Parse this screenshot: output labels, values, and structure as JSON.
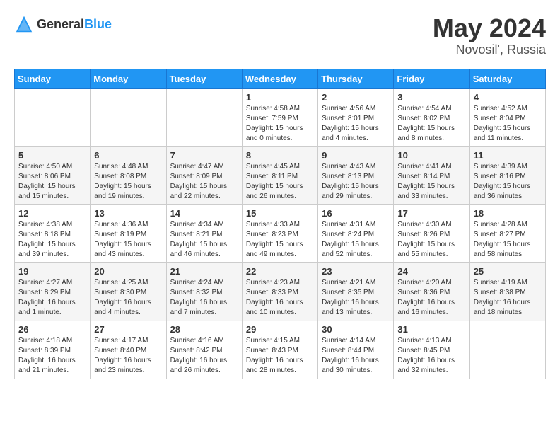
{
  "logo": {
    "general": "General",
    "blue": "Blue"
  },
  "title": {
    "month_year": "May 2024",
    "location": "Novosil', Russia"
  },
  "headers": [
    "Sunday",
    "Monday",
    "Tuesday",
    "Wednesday",
    "Thursday",
    "Friday",
    "Saturday"
  ],
  "weeks": [
    [
      {
        "day": "",
        "info": ""
      },
      {
        "day": "",
        "info": ""
      },
      {
        "day": "",
        "info": ""
      },
      {
        "day": "1",
        "info": "Sunrise: 4:58 AM\nSunset: 7:59 PM\nDaylight: 15 hours\nand 0 minutes."
      },
      {
        "day": "2",
        "info": "Sunrise: 4:56 AM\nSunset: 8:01 PM\nDaylight: 15 hours\nand 4 minutes."
      },
      {
        "day": "3",
        "info": "Sunrise: 4:54 AM\nSunset: 8:02 PM\nDaylight: 15 hours\nand 8 minutes."
      },
      {
        "day": "4",
        "info": "Sunrise: 4:52 AM\nSunset: 8:04 PM\nDaylight: 15 hours\nand 11 minutes."
      }
    ],
    [
      {
        "day": "5",
        "info": "Sunrise: 4:50 AM\nSunset: 8:06 PM\nDaylight: 15 hours\nand 15 minutes."
      },
      {
        "day": "6",
        "info": "Sunrise: 4:48 AM\nSunset: 8:08 PM\nDaylight: 15 hours\nand 19 minutes."
      },
      {
        "day": "7",
        "info": "Sunrise: 4:47 AM\nSunset: 8:09 PM\nDaylight: 15 hours\nand 22 minutes."
      },
      {
        "day": "8",
        "info": "Sunrise: 4:45 AM\nSunset: 8:11 PM\nDaylight: 15 hours\nand 26 minutes."
      },
      {
        "day": "9",
        "info": "Sunrise: 4:43 AM\nSunset: 8:13 PM\nDaylight: 15 hours\nand 29 minutes."
      },
      {
        "day": "10",
        "info": "Sunrise: 4:41 AM\nSunset: 8:14 PM\nDaylight: 15 hours\nand 33 minutes."
      },
      {
        "day": "11",
        "info": "Sunrise: 4:39 AM\nSunset: 8:16 PM\nDaylight: 15 hours\nand 36 minutes."
      }
    ],
    [
      {
        "day": "12",
        "info": "Sunrise: 4:38 AM\nSunset: 8:18 PM\nDaylight: 15 hours\nand 39 minutes."
      },
      {
        "day": "13",
        "info": "Sunrise: 4:36 AM\nSunset: 8:19 PM\nDaylight: 15 hours\nand 43 minutes."
      },
      {
        "day": "14",
        "info": "Sunrise: 4:34 AM\nSunset: 8:21 PM\nDaylight: 15 hours\nand 46 minutes."
      },
      {
        "day": "15",
        "info": "Sunrise: 4:33 AM\nSunset: 8:23 PM\nDaylight: 15 hours\nand 49 minutes."
      },
      {
        "day": "16",
        "info": "Sunrise: 4:31 AM\nSunset: 8:24 PM\nDaylight: 15 hours\nand 52 minutes."
      },
      {
        "day": "17",
        "info": "Sunrise: 4:30 AM\nSunset: 8:26 PM\nDaylight: 15 hours\nand 55 minutes."
      },
      {
        "day": "18",
        "info": "Sunrise: 4:28 AM\nSunset: 8:27 PM\nDaylight: 15 hours\nand 58 minutes."
      }
    ],
    [
      {
        "day": "19",
        "info": "Sunrise: 4:27 AM\nSunset: 8:29 PM\nDaylight: 16 hours\nand 1 minute."
      },
      {
        "day": "20",
        "info": "Sunrise: 4:25 AM\nSunset: 8:30 PM\nDaylight: 16 hours\nand 4 minutes."
      },
      {
        "day": "21",
        "info": "Sunrise: 4:24 AM\nSunset: 8:32 PM\nDaylight: 16 hours\nand 7 minutes."
      },
      {
        "day": "22",
        "info": "Sunrise: 4:23 AM\nSunset: 8:33 PM\nDaylight: 16 hours\nand 10 minutes."
      },
      {
        "day": "23",
        "info": "Sunrise: 4:21 AM\nSunset: 8:35 PM\nDaylight: 16 hours\nand 13 minutes."
      },
      {
        "day": "24",
        "info": "Sunrise: 4:20 AM\nSunset: 8:36 PM\nDaylight: 16 hours\nand 16 minutes."
      },
      {
        "day": "25",
        "info": "Sunrise: 4:19 AM\nSunset: 8:38 PM\nDaylight: 16 hours\nand 18 minutes."
      }
    ],
    [
      {
        "day": "26",
        "info": "Sunrise: 4:18 AM\nSunset: 8:39 PM\nDaylight: 16 hours\nand 21 minutes."
      },
      {
        "day": "27",
        "info": "Sunrise: 4:17 AM\nSunset: 8:40 PM\nDaylight: 16 hours\nand 23 minutes."
      },
      {
        "day": "28",
        "info": "Sunrise: 4:16 AM\nSunset: 8:42 PM\nDaylight: 16 hours\nand 26 minutes."
      },
      {
        "day": "29",
        "info": "Sunrise: 4:15 AM\nSunset: 8:43 PM\nDaylight: 16 hours\nand 28 minutes."
      },
      {
        "day": "30",
        "info": "Sunrise: 4:14 AM\nSunset: 8:44 PM\nDaylight: 16 hours\nand 30 minutes."
      },
      {
        "day": "31",
        "info": "Sunrise: 4:13 AM\nSunset: 8:45 PM\nDaylight: 16 hours\nand 32 minutes."
      },
      {
        "day": "",
        "info": ""
      }
    ]
  ]
}
